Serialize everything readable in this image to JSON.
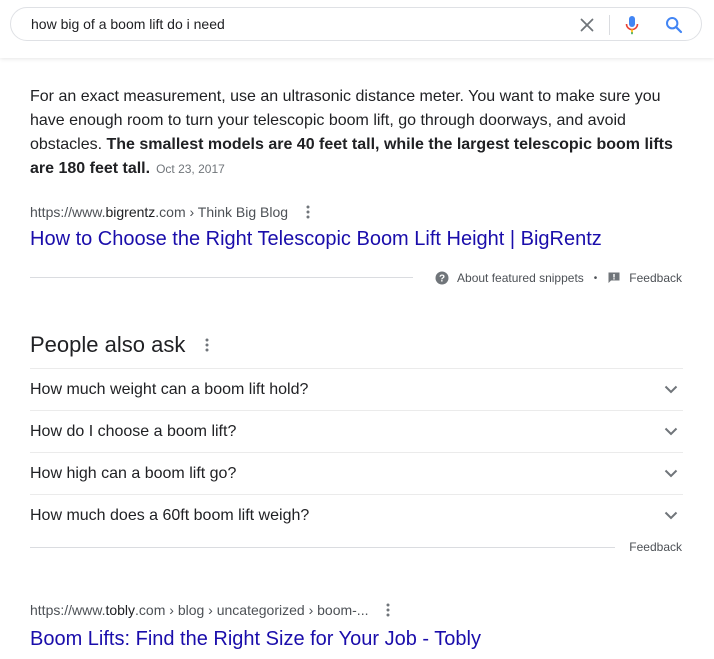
{
  "search": {
    "query": "how big of a boom lift do i need"
  },
  "snippet": {
    "text_normal": "For an exact measurement, use an ultrasonic distance meter. You want to make sure you have enough room to turn your telescopic boom lift, go through doorways, and avoid obstacles. ",
    "text_bold": "The smallest models are 40 feet tall, while the largest telescopic boom lifts are 180 feet tall.",
    "date": "Oct 23, 2017",
    "cite": {
      "prefix": "https://www.",
      "domain": "bigrentz",
      "suffix": ".com › Think Big Blog"
    },
    "title": "How to Choose the Right Telescopic Boom Lift Height | BigRentz",
    "about_label": "About featured snippets",
    "separator": "•",
    "feedback_label": "Feedback"
  },
  "paa": {
    "heading": "People also ask",
    "questions": [
      "How much weight can a boom lift hold?",
      "How do I choose a boom lift?",
      "How high can a boom lift go?",
      "How much does a 60ft boom lift weigh?"
    ],
    "feedback_label": "Feedback"
  },
  "result2": {
    "cite": {
      "prefix": "https://www.",
      "domain": "tobly",
      "suffix": ".com › blog › uncategorized › boom-..."
    },
    "title": "Boom Lifts: Find the Right Size for Your Job - Tobly"
  },
  "icons": {
    "clear": "close-icon",
    "mic": "mic-icon",
    "search": "search-icon",
    "more": "more-vert-icon",
    "help": "help-icon",
    "feedback": "feedback-icon",
    "expand": "chevron-down-icon"
  },
  "colors": {
    "link": "#1a0dab",
    "text": "#202124",
    "secondary": "#4d5156",
    "muted": "#70757a",
    "search_blue": "#4285f4"
  }
}
